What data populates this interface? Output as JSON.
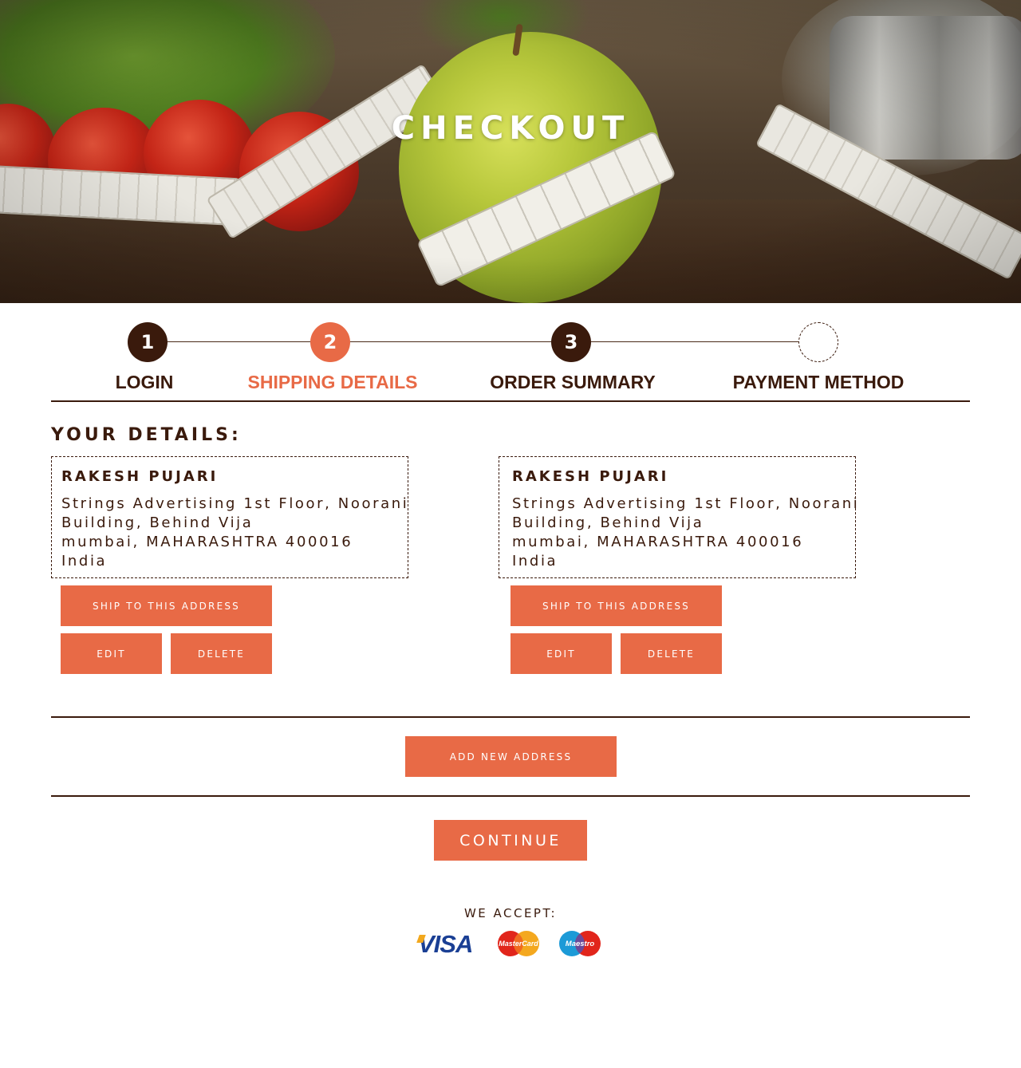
{
  "hero": {
    "title": "CHECKOUT"
  },
  "steps": [
    {
      "number": "1",
      "label": "LOGIN",
      "state": "done"
    },
    {
      "number": "2",
      "label": "SHIPPING DETAILS",
      "state": "active"
    },
    {
      "number": "3",
      "label": "ORDER SUMMARY",
      "state": "done"
    },
    {
      "number": "",
      "label": "PAYMENT METHOD",
      "state": "todo"
    }
  ],
  "details": {
    "title": "YOUR DETAILS:",
    "addresses": [
      {
        "name": "RAKESH PUJARI",
        "line1": "Strings Advertising 1st Floor, Noorani",
        "line2": "Building, Behind Vija",
        "line3": "mumbai, MAHARASHTRA 400016",
        "line4": "India",
        "ship_label": "SHIP TO THIS ADDRESS",
        "edit_label": "EDIT",
        "delete_label": "DELETE"
      },
      {
        "name": "RAKESH PUJARI",
        "line1": "Strings Advertising 1st Floor, Noorani",
        "line2": "Building, Behind Vija",
        "line3": "mumbai, MAHARASHTRA 400016",
        "line4": "India",
        "ship_label": "SHIP TO THIS ADDRESS",
        "edit_label": "EDIT",
        "delete_label": "DELETE"
      }
    ],
    "add_new_label": "ADD NEW ADDRESS",
    "continue_label": "CONTINUE"
  },
  "accept": {
    "title": "WE ACCEPT:",
    "cards": [
      "VISA",
      "MasterCard",
      "Maestro"
    ]
  },
  "colors": {
    "accent": "#e86a46",
    "dark": "#3a1a0c",
    "background": "#ffffff"
  },
  "icons": [
    "visa-logo",
    "mastercard-logo",
    "maestro-logo"
  ]
}
